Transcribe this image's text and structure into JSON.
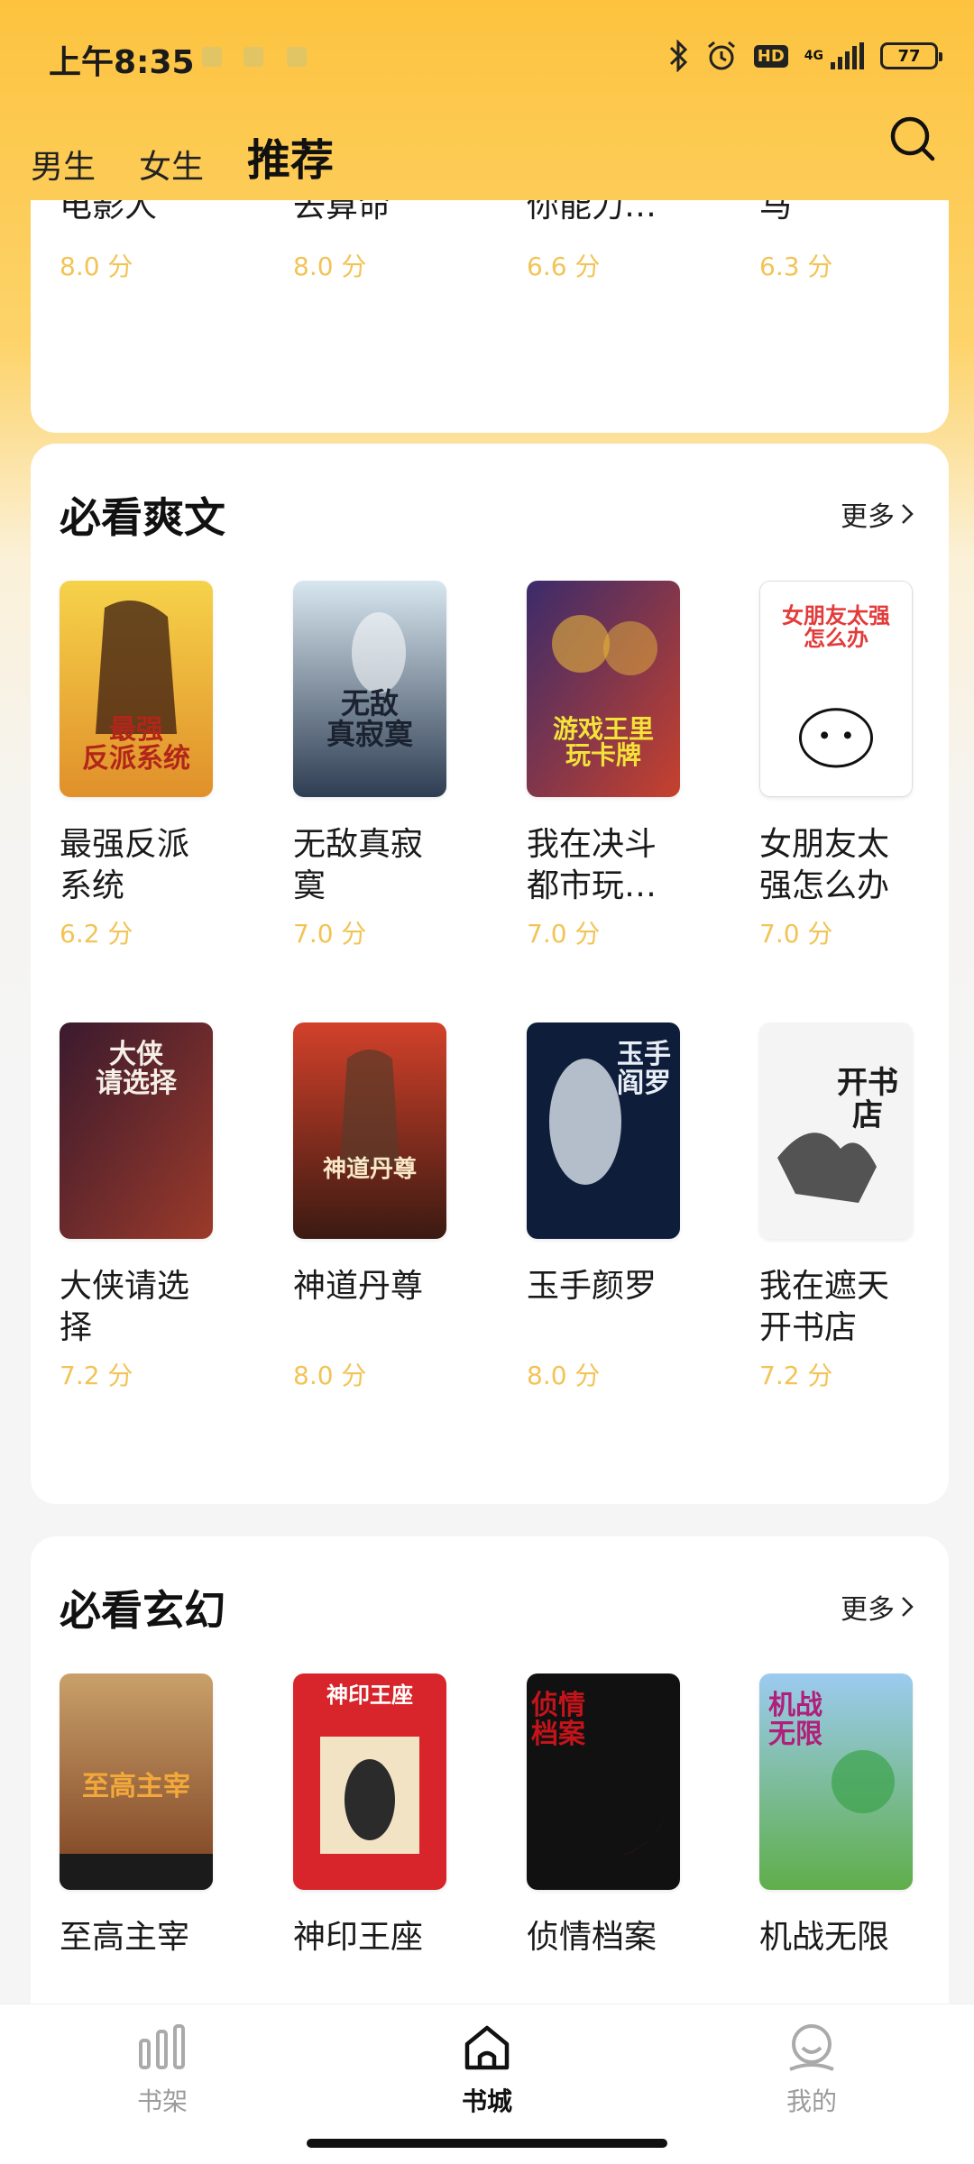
{
  "status_bar": {
    "time": "上午8:35",
    "network": "4G",
    "hd": "HD",
    "battery": "77"
  },
  "header": {
    "tabs": [
      {
        "label": "男生",
        "active": false
      },
      {
        "label": "女生",
        "active": false
      },
      {
        "label": "推荐",
        "active": true
      }
    ]
  },
  "partial_section": {
    "books": [
      {
        "title": "我在港岛\n电影人",
        "score": "8.0 分"
      },
      {
        "title": "系统让我\n去算命",
        "score": "8.0 分"
      },
      {
        "title": "手把手教\n你能力…",
        "score": "6.6 分"
      },
      {
        "title": "我要做驸\n马",
        "score": "6.3 分"
      }
    ]
  },
  "section_1": {
    "title": "必看爽文",
    "more_label": "更多",
    "books": [
      {
        "title": "最强反派系统",
        "score": "6.2 分",
        "cover_text": "最强\n反派系统",
        "cover_colors": [
          "#f6d24a",
          "#b2261a"
        ]
      },
      {
        "title": "无敌真寂寞",
        "score": "7.0 分",
        "cover_text": "无敌\n真寂寞",
        "cover_colors": [
          "#c7dbe8",
          "#2e3d52"
        ]
      },
      {
        "title": "我在决斗都市玩…",
        "score": "7.0 分",
        "cover_text": "游戏王里\n玩卡牌",
        "cover_colors": [
          "#3b2b6b",
          "#c7412d"
        ]
      },
      {
        "title": "女朋友太强怎么办",
        "score": "7.0 分",
        "cover_text": "女朋友太强\n怎么办",
        "cover_colors": [
          "#ffffff",
          "#e23b3b"
        ]
      },
      {
        "title": "大侠请选择",
        "score": "7.2 分",
        "cover_text": "大侠\n请选择",
        "cover_colors": [
          "#3a1a2e",
          "#9b3a2a"
        ]
      },
      {
        "title": "神道丹尊",
        "score": "8.0 分",
        "cover_text": "神道丹尊",
        "cover_colors": [
          "#d2412a",
          "#3b1a12"
        ]
      },
      {
        "title": "玉手颜罗",
        "score": "8.0 分",
        "cover_text": "玉手\n阎罗",
        "cover_colors": [
          "#0e1d3a",
          "#dfe6ef"
        ]
      },
      {
        "title": "我在遮天开书店",
        "score": "7.2 分",
        "cover_text": "开书店",
        "cover_colors": [
          "#f4f4f4",
          "#1b1b1b"
        ]
      }
    ]
  },
  "section_2": {
    "title": "必看玄幻",
    "more_label": "更多",
    "books": [
      {
        "title": "至高主宰",
        "cover_text": "至高主宰",
        "cover_colors": [
          "#7a3d1e",
          "#e3a23a"
        ]
      },
      {
        "title": "神印王座",
        "cover_text": "神印王座",
        "cover_colors": [
          "#d8252b",
          "#7b1414"
        ]
      },
      {
        "title": "侦情档案",
        "cover_text": "侦情\n档案",
        "cover_colors": [
          "#111111",
          "#c2141a"
        ]
      },
      {
        "title": "机战无限",
        "cover_text": "机战\n无限",
        "cover_colors": [
          "#7fb4e3",
          "#5fae4a"
        ]
      }
    ]
  },
  "bottom_nav": {
    "items": [
      {
        "label": "书架",
        "active": false
      },
      {
        "label": "书城",
        "active": true
      },
      {
        "label": "我的",
        "active": false
      }
    ]
  },
  "colors": {
    "accent": "#fdc33f",
    "score": "#f2c457"
  }
}
